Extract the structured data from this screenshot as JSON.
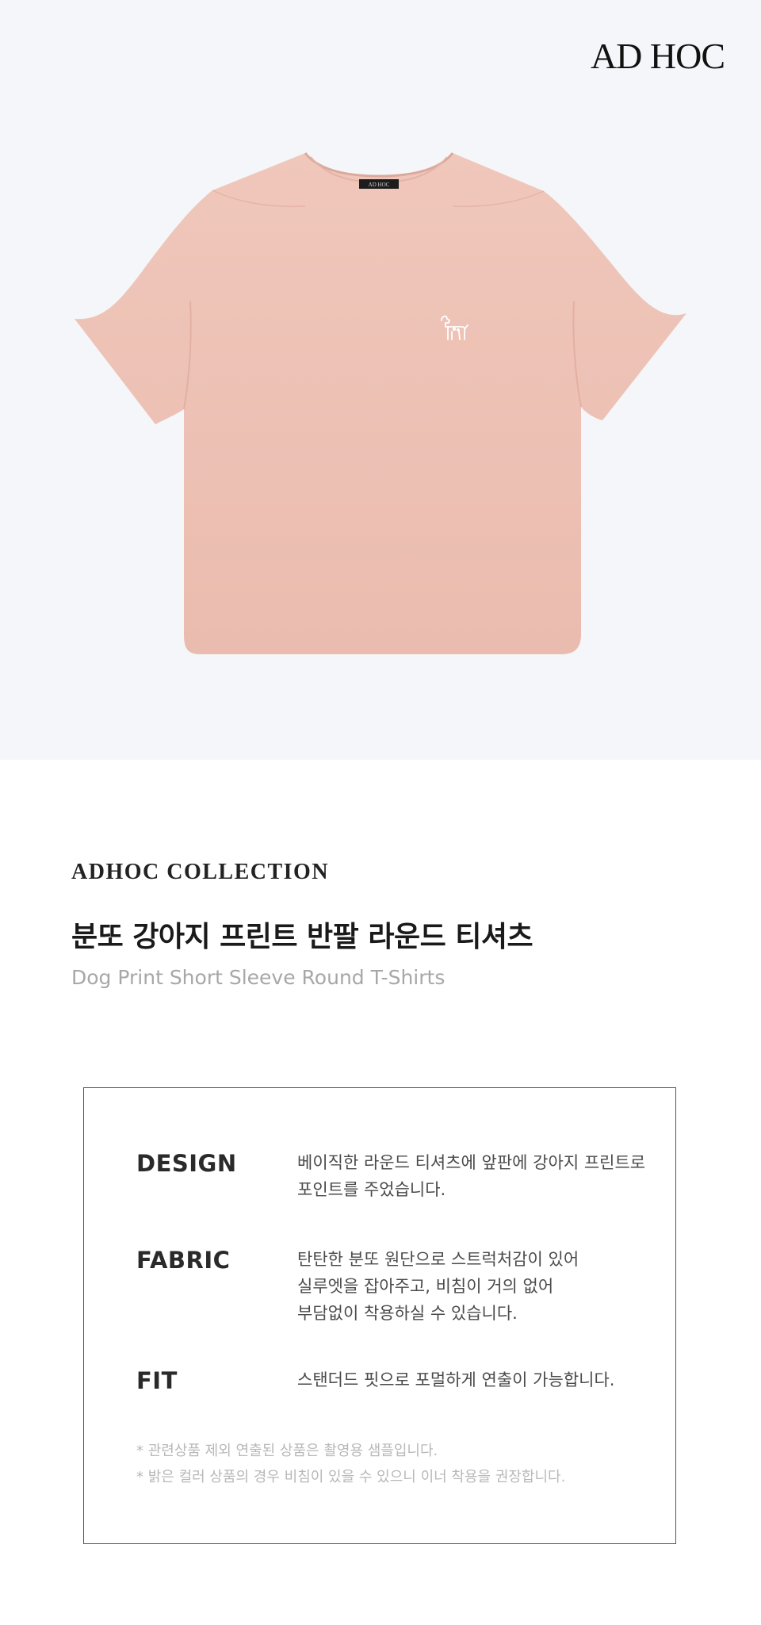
{
  "brand": {
    "logo_text": "AD HOC"
  },
  "product_image": {
    "color": "#eec2b6",
    "label_text": "AD HOC",
    "print_motif": "dog-icon"
  },
  "collection_label": "ADHOC COLLECTION",
  "product": {
    "title_ko": "분또 강아지 프린트 반팔 라운드 티셔츠",
    "title_en": "Dog Print Short Sleeve Round T-Shirts"
  },
  "details": [
    {
      "key": "DESIGN",
      "lines": [
        "베이직한 라운드 티셔츠에 앞판에 강아지 프린트로",
        "포인트를 주었습니다."
      ]
    },
    {
      "key": "FABRIC",
      "lines": [
        "탄탄한 분또 원단으로 스트럭처감이 있어",
        "실루엣을 잡아주고, 비침이 거의 없어",
        "부담없이 착용하실 수 있습니다."
      ]
    },
    {
      "key": "FIT",
      "lines": [
        "스탠더드 핏으로 포멀하게 연출이 가능합니다."
      ]
    }
  ],
  "notes": [
    "* 관련상품 제외 연출된 상품은 촬영용 샘플입니다.",
    "* 밝은 컬러 상품의 경우 비침이 있을 수 있으니 이너 착용을 권장합니다."
  ],
  "colors": {
    "hero_bg": "#f4f6f9",
    "shirt": "#eec2b6",
    "text_muted": "#a7a7a7",
    "border": "#555555"
  }
}
